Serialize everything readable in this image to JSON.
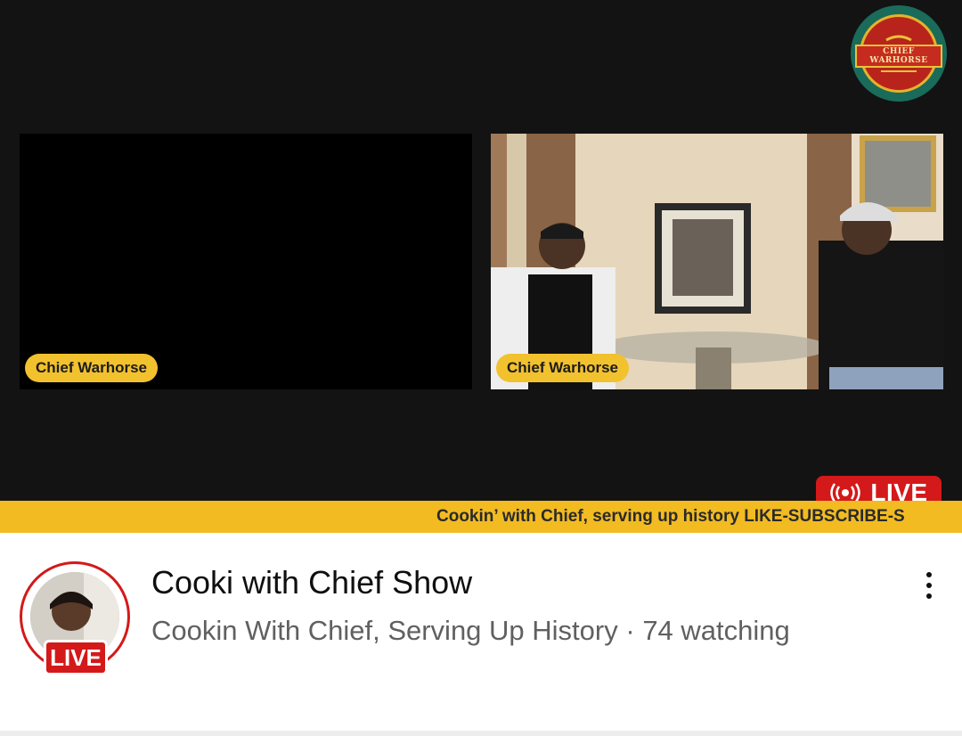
{
  "logo": {
    "text": "CHIEF WARHORSE",
    "colors": {
      "ring": "#1a6b5a",
      "center": "#b8241c",
      "border": "#e6b32a"
    }
  },
  "video_tiles": [
    {
      "name_label": "Chief Warhorse"
    },
    {
      "name_label": "Chief Warhorse"
    }
  ],
  "live_badge": {
    "icon": "broadcast-icon",
    "label": "LIVE",
    "color": "#d4191a"
  },
  "ticker": {
    "text": "Cookin’ with Chief, serving up history LIKE-SUBSCRIBE-S",
    "color": "#f2bb22"
  },
  "stream": {
    "title": "Cooki with Chief Show",
    "channel": "Cookin With Chief, Serving Up History",
    "separator": "·",
    "viewers": "74 watching",
    "avatar_live_label": "LIVE",
    "more_icon": "more-vert-icon"
  }
}
